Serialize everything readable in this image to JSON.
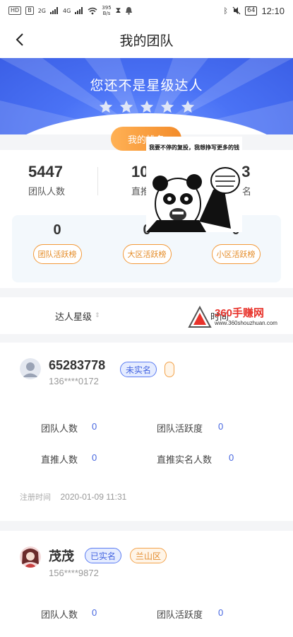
{
  "status_bar": {
    "left_chips": [
      "HD",
      "B"
    ],
    "signal_labels": [
      "2G",
      "4G"
    ],
    "speed": "395",
    "speed_unit": "B/s",
    "battery": "64",
    "time": "12:10"
  },
  "nav": {
    "title": "我的团队"
  },
  "banner": {
    "title": "您还不是星级达人",
    "star_count": 5
  },
  "my_rank_button": "我的排名",
  "stats": {
    "team_count_value": "5447",
    "team_count_label": "团队人数",
    "direct_value": "10",
    "direct_label": "直推",
    "realname_value": "23",
    "realname_label": "实名"
  },
  "activity": [
    {
      "value": "0",
      "label": "团队活跃榜"
    },
    {
      "value": "0",
      "label": "大区活跃榜"
    },
    {
      "value": "0",
      "label": "小区活跃榜"
    }
  ],
  "filter": {
    "star_label": "达人星级",
    "arrow": "⇕",
    "other_label": "时间"
  },
  "watermark": {
    "name": "360手赚网",
    "url": "www.360shouzhuan.com"
  },
  "sticker": {
    "caption": "我要不停的复投，我想挣写更多的钱"
  },
  "members": [
    {
      "id": "65283778",
      "phone": "136****0172",
      "tag1": "未实名",
      "tag2": "",
      "team_count_label": "团队人数",
      "team_count": "0",
      "activity_label": "团队活跃度",
      "activity": "0",
      "direct_label": "直推人数",
      "direct": "0",
      "direct_realname_label": "直推实名人数",
      "direct_realname": "0",
      "reg_label": "注册时间",
      "reg_time": "2020-01-09 11:31"
    },
    {
      "id": "茂茂",
      "phone": "156****9872",
      "tag1": "已实名",
      "tag2": "兰山区",
      "team_count_label": "团队人数",
      "team_count": "0",
      "activity_label": "团队活跃度",
      "activity": "0"
    }
  ],
  "colors": {
    "banner_blue": "#4a72f5",
    "accent_orange": "#f38c2b",
    "tag_blue": "#5b7cf2",
    "value_blue": "#4666e0"
  }
}
